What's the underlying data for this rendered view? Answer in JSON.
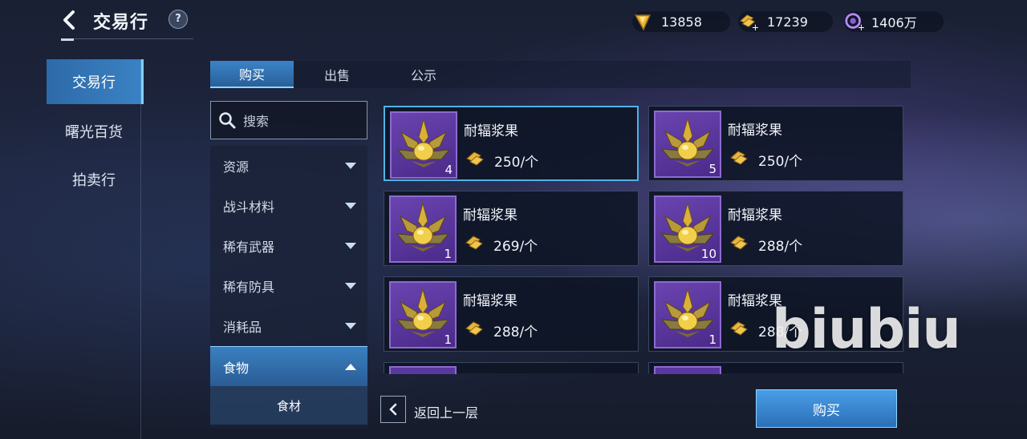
{
  "header": {
    "title": "交易行",
    "help_label": "?",
    "currencies": [
      {
        "icon": "gold-crystal-icon",
        "value": "13858"
      },
      {
        "icon": "gold-ingot-plus-icon",
        "value": "17239"
      },
      {
        "icon": "purple-gem-plus-icon",
        "value": "1406万"
      }
    ]
  },
  "sidebar": {
    "items": [
      {
        "label": "交易行",
        "active": true
      },
      {
        "label": "曙光百货",
        "active": false
      },
      {
        "label": "拍卖行",
        "active": false
      }
    ]
  },
  "tabs": [
    {
      "label": "购买",
      "active": true
    },
    {
      "label": "出售",
      "active": false
    },
    {
      "label": "公示",
      "active": false
    }
  ],
  "search": {
    "placeholder": "搜索"
  },
  "categories": [
    {
      "label": "资源",
      "expanded": false
    },
    {
      "label": "战斗材料",
      "expanded": false
    },
    {
      "label": "稀有武器",
      "expanded": false
    },
    {
      "label": "稀有防具",
      "expanded": false
    },
    {
      "label": "消耗品",
      "expanded": false
    },
    {
      "label": "食物",
      "expanded": true
    }
  ],
  "subcategory": {
    "label": "食材"
  },
  "listings": [
    {
      "name": "耐辐浆果",
      "price": "250/个",
      "qty": "4",
      "selected": true
    },
    {
      "name": "耐辐浆果",
      "price": "250/个",
      "qty": "5",
      "selected": false
    },
    {
      "name": "耐辐浆果",
      "price": "269/个",
      "qty": "1",
      "selected": false
    },
    {
      "name": "耐辐浆果",
      "price": "288/个",
      "qty": "10",
      "selected": false
    },
    {
      "name": "耐辐浆果",
      "price": "288/个",
      "qty": "1",
      "selected": false
    },
    {
      "name": "耐辐浆果",
      "price": "288/个",
      "qty": "1",
      "selected": false
    }
  ],
  "footer": {
    "back_label": "返回上一层",
    "buy_label": "购买"
  },
  "watermark": "biubiu",
  "colors": {
    "accent": "#3a82c4",
    "item_slot": "#5a38a0",
    "gold": "#e8b53a"
  }
}
